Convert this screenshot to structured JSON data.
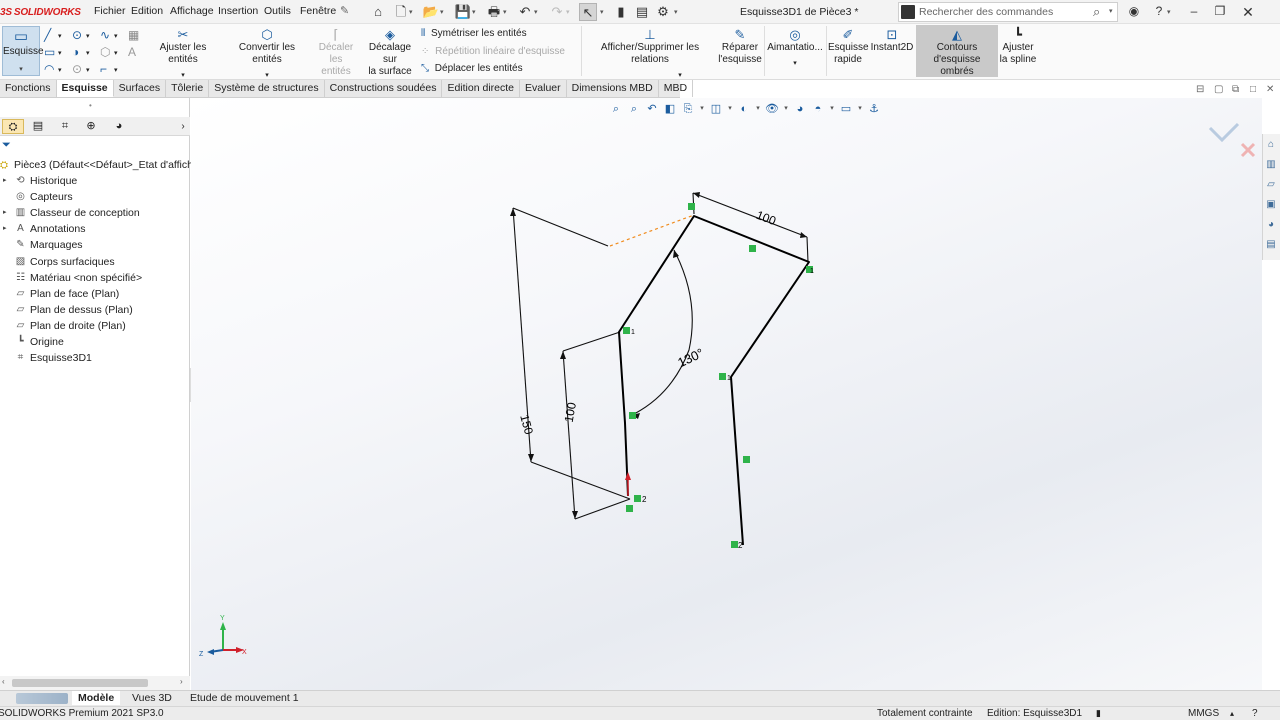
{
  "app": {
    "logo_prefix": "3S",
    "logo_name": "SOLIDWORKS"
  },
  "menu": [
    "Fichier",
    "Edition",
    "Affichage",
    "Insertion",
    "Outils",
    "Fenêtre"
  ],
  "pin_icon": "pin-icon",
  "document_title": "Esquisse3D1 de Pièce3 *",
  "command_search": {
    "placeholder": "Rechercher des commandes"
  },
  "ribbon": {
    "esquisse": "Esquisse",
    "ajuster_entites": "Ajuster les entités",
    "convertir_entites": "Convertir les entités",
    "decaler_entites": [
      "Décaler les",
      "entités"
    ],
    "decalage_surface": [
      "Décalage sur",
      "la surface"
    ],
    "symetriser": "Symétriser les entités",
    "repetition": "Répétition linéaire d'esquisse",
    "deplacer": "Déplacer les entités",
    "afficher_relations": "Afficher/Supprimer les relations",
    "reparer": [
      "Réparer",
      "l'esquisse"
    ],
    "aimantation": "Aimantatio...",
    "esquisse_rapide": [
      "Esquisse",
      "rapide"
    ],
    "instant2d": "Instant2D",
    "contours": [
      "Contours",
      "d'esquisse ombrés"
    ],
    "ajuster_spline": [
      "Ajuster",
      "la spline"
    ]
  },
  "tabs": [
    {
      "label": "Fonctions",
      "active": false
    },
    {
      "label": "Esquisse",
      "active": true
    },
    {
      "label": "Surfaces",
      "active": false
    },
    {
      "label": "Tôlerie",
      "active": false
    },
    {
      "label": "Système de structures",
      "active": false
    },
    {
      "label": "Constructions soudées",
      "active": false
    },
    {
      "label": "Edition directe",
      "active": false
    },
    {
      "label": "Evaluer",
      "active": false
    },
    {
      "label": "Dimensions MBD",
      "active": false
    },
    {
      "label": "MBD",
      "active": false
    }
  ],
  "feature_tree": {
    "root": "Pièce3  (Défaut<<Défaut>_Etat d'affich",
    "items": [
      {
        "label": "Historique",
        "expandable": true,
        "icon": "history-icon"
      },
      {
        "label": "Capteurs",
        "expandable": false,
        "icon": "sensor-icon"
      },
      {
        "label": "Classeur de conception",
        "expandable": true,
        "icon": "binder-icon"
      },
      {
        "label": "Annotations",
        "expandable": true,
        "icon": "annotations-icon"
      },
      {
        "label": "Marquages",
        "expandable": false,
        "icon": "markup-icon"
      },
      {
        "label": "Corps surfaciques",
        "expandable": false,
        "icon": "surface-bodies-icon"
      },
      {
        "label": "Matériau <non spécifié>",
        "expandable": false,
        "icon": "material-icon"
      },
      {
        "label": "Plan de face (Plan)",
        "expandable": false,
        "icon": "plane-icon"
      },
      {
        "label": "Plan de dessus (Plan)",
        "expandable": false,
        "icon": "plane-icon"
      },
      {
        "label": "Plan de droite (Plan)",
        "expandable": false,
        "icon": "plane-icon"
      },
      {
        "label": "Origine",
        "expandable": false,
        "icon": "origin-icon"
      },
      {
        "label": "Esquisse3D1",
        "expandable": false,
        "icon": "sketch3d-icon"
      }
    ]
  },
  "sketch": {
    "dimensions": {
      "d_top": "100",
      "d_angle": "130°",
      "d_left_outer": "150",
      "d_left_inner": "100"
    },
    "point_labels": {
      "p1": "1",
      "p2": "1",
      "p3": "2",
      "p4": "1",
      "p5": "2"
    }
  },
  "triad": {
    "x": "X",
    "y": "Y",
    "z": "Z"
  },
  "bottom_tabs": [
    {
      "label": "Modèle",
      "active": true
    },
    {
      "label": "Vues 3D",
      "active": false
    },
    {
      "label": "Etude de mouvement 1",
      "active": false
    }
  ],
  "status": {
    "product": "SOLIDWORKS Premium 2021 SP3.0",
    "constraint": "Totalement contrainte",
    "editing": "Edition: Esquisse3D1",
    "units": "MMGS"
  },
  "colors": {
    "accent": "#1b5c9e",
    "sketch_line": "#000000",
    "relation_green": "#2fb34a",
    "inference_orange": "#f08c1e",
    "origin_red": "#d0202a"
  }
}
